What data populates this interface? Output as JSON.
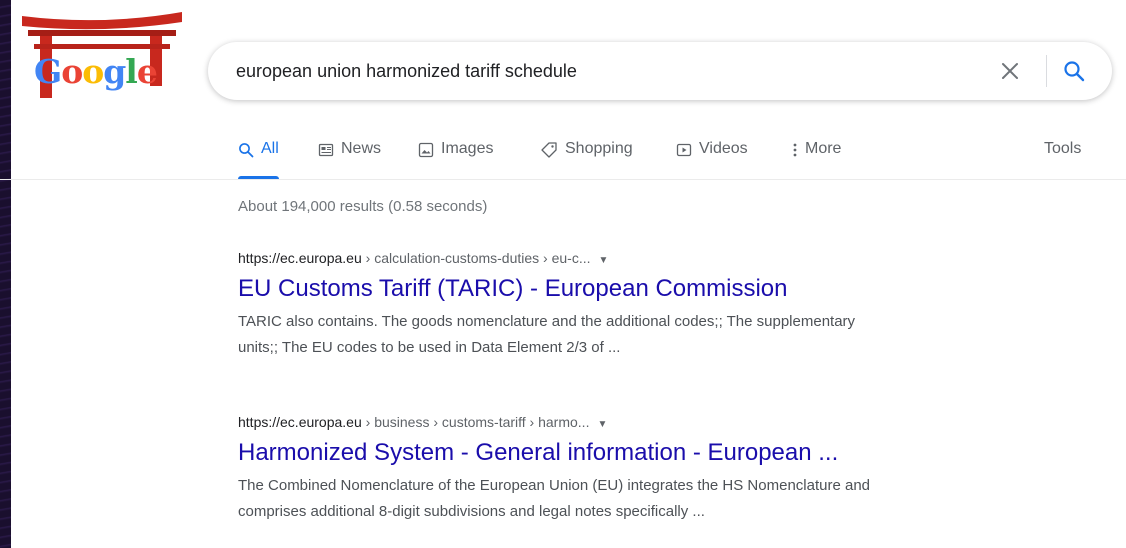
{
  "logo": {
    "letters": [
      "G",
      "o",
      "o",
      "g",
      "l",
      "e"
    ],
    "alt": "Google"
  },
  "search": {
    "query": "european union harmonized tariff schedule"
  },
  "tabs": [
    {
      "label": "All",
      "icon": "search-icon",
      "active": true
    },
    {
      "label": "News",
      "icon": "news-icon",
      "active": false
    },
    {
      "label": "Images",
      "icon": "image-icon",
      "active": false
    },
    {
      "label": "Shopping",
      "icon": "tag-icon",
      "active": false
    },
    {
      "label": "Videos",
      "icon": "play-icon",
      "active": false
    },
    {
      "label": "More",
      "icon": "more-vert-icon",
      "active": false
    }
  ],
  "tools_label": "Tools",
  "stats": "About 194,000 results (0.58 seconds)",
  "results": [
    {
      "domain": "https://ec.europa.eu",
      "path": " › calculation-customs-duties › eu-c...",
      "title": "EU Customs Tariff (TARIC) - European Commission",
      "snippet_line1": "TARIC also contains. The goods nomenclature and the additional codes;; The supplementary",
      "snippet_line2": "units;; The EU codes to be used in Data Element 2/3 of ..."
    },
    {
      "domain": "https://ec.europa.eu",
      "path": " › business › customs-tariff › harmo...",
      "title": "Harmonized System - General information - European ...",
      "snippet_line1": "The Combined Nomenclature of the European Union (EU) integrates the HS Nomenclature and",
      "snippet_line2": "comprises additional 8-digit subdivisions and legal notes specifically ..."
    }
  ],
  "colors": {
    "accent": "#1a73e8",
    "link": "#1a0dab",
    "torii": "#c8281e"
  }
}
